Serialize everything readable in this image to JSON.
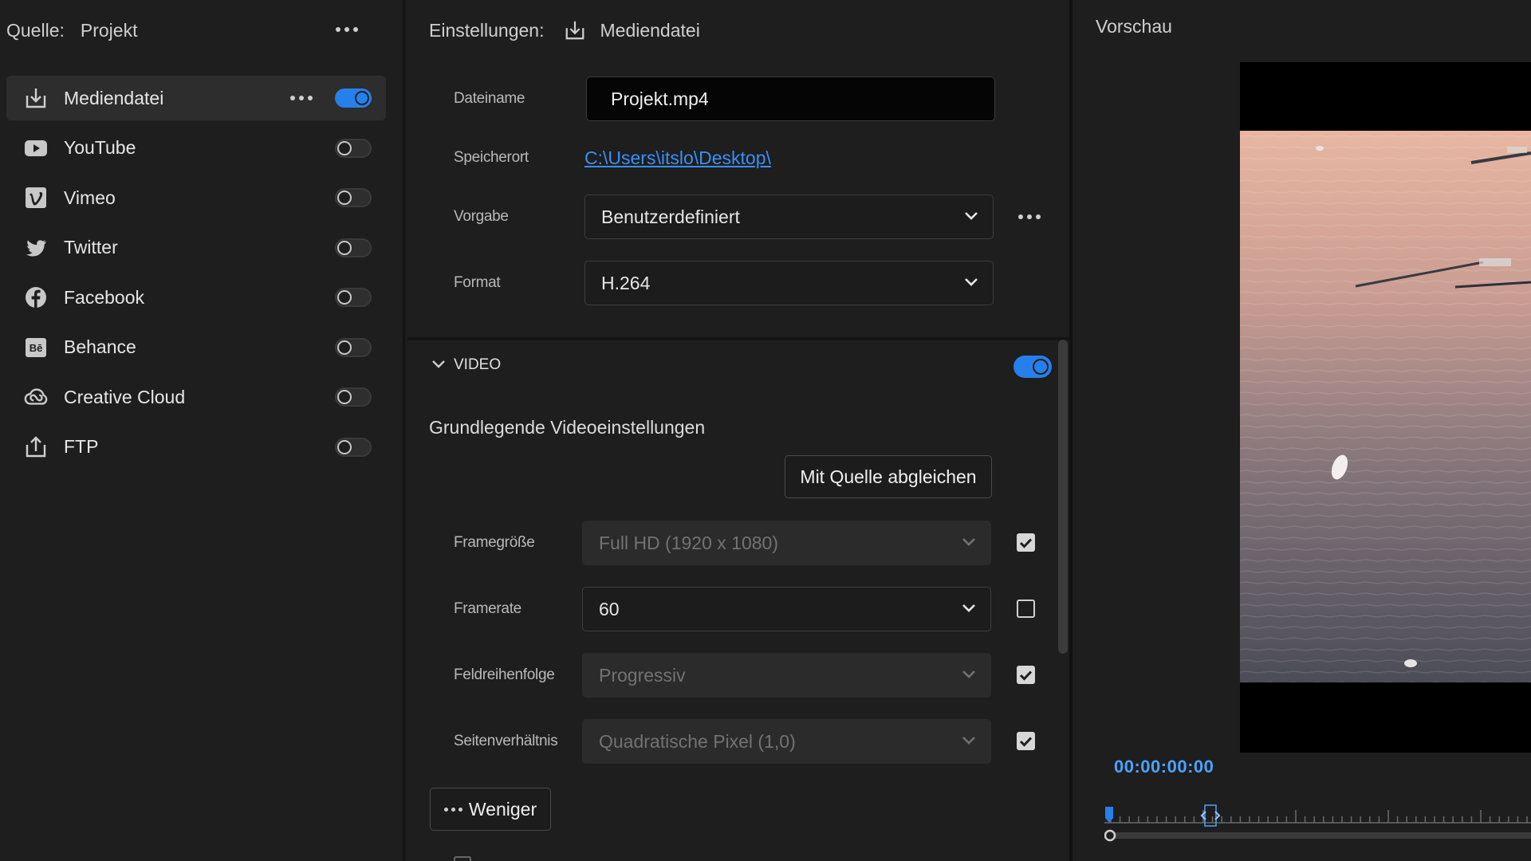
{
  "source": {
    "label": "Quelle:",
    "value": "Projekt"
  },
  "destinations": [
    {
      "label": "Mediendatei",
      "icon": "download-icon",
      "enabled": true,
      "active": true
    },
    {
      "label": "YouTube",
      "icon": "youtube-icon",
      "enabled": false
    },
    {
      "label": "Vimeo",
      "icon": "vimeo-icon",
      "enabled": false
    },
    {
      "label": "Twitter",
      "icon": "twitter-icon",
      "enabled": false
    },
    {
      "label": "Facebook",
      "icon": "facebook-icon",
      "enabled": false
    },
    {
      "label": "Behance",
      "icon": "behance-icon",
      "enabled": false
    },
    {
      "label": "Creative Cloud",
      "icon": "creative-cloud-icon",
      "enabled": false
    },
    {
      "label": "FTP",
      "icon": "upload-icon",
      "enabled": false
    }
  ],
  "settings": {
    "header_label": "Einstellungen:",
    "header_value": "Mediendatei",
    "filename_label": "Dateiname",
    "filename_value": "Projekt.mp4",
    "location_label": "Speicherort",
    "location_value": "C:\\Users\\itslo\\Desktop\\",
    "preset_label": "Vorgabe",
    "preset_value": "Benutzerdefiniert",
    "format_label": "Format",
    "format_value": "H.264"
  },
  "video": {
    "section_title": "VIDEO",
    "enabled": true,
    "subheading": "Grundlegende Videoeinstellungen",
    "match_source_button": "Mit Quelle abgleichen",
    "frame_size_label": "Framegröße",
    "frame_size_value": "Full HD (1920 x 1080)",
    "frame_size_checked": true,
    "frame_rate_label": "Framerate",
    "frame_rate_value": "60",
    "frame_rate_checked": false,
    "field_order_label": "Feldreihenfolge",
    "field_order_value": "Progressiv",
    "field_order_checked": true,
    "aspect_label": "Seitenverhältnis",
    "aspect_value": "Quadratische Pixel (1,0)",
    "aspect_checked": true,
    "less_button": "Weniger"
  },
  "preview": {
    "title": "Vorschau",
    "timecode": "00:00:00:00"
  },
  "colors": {
    "accent": "#2680eb",
    "link": "#3b8ff5",
    "timecode": "#4aa3ff"
  }
}
